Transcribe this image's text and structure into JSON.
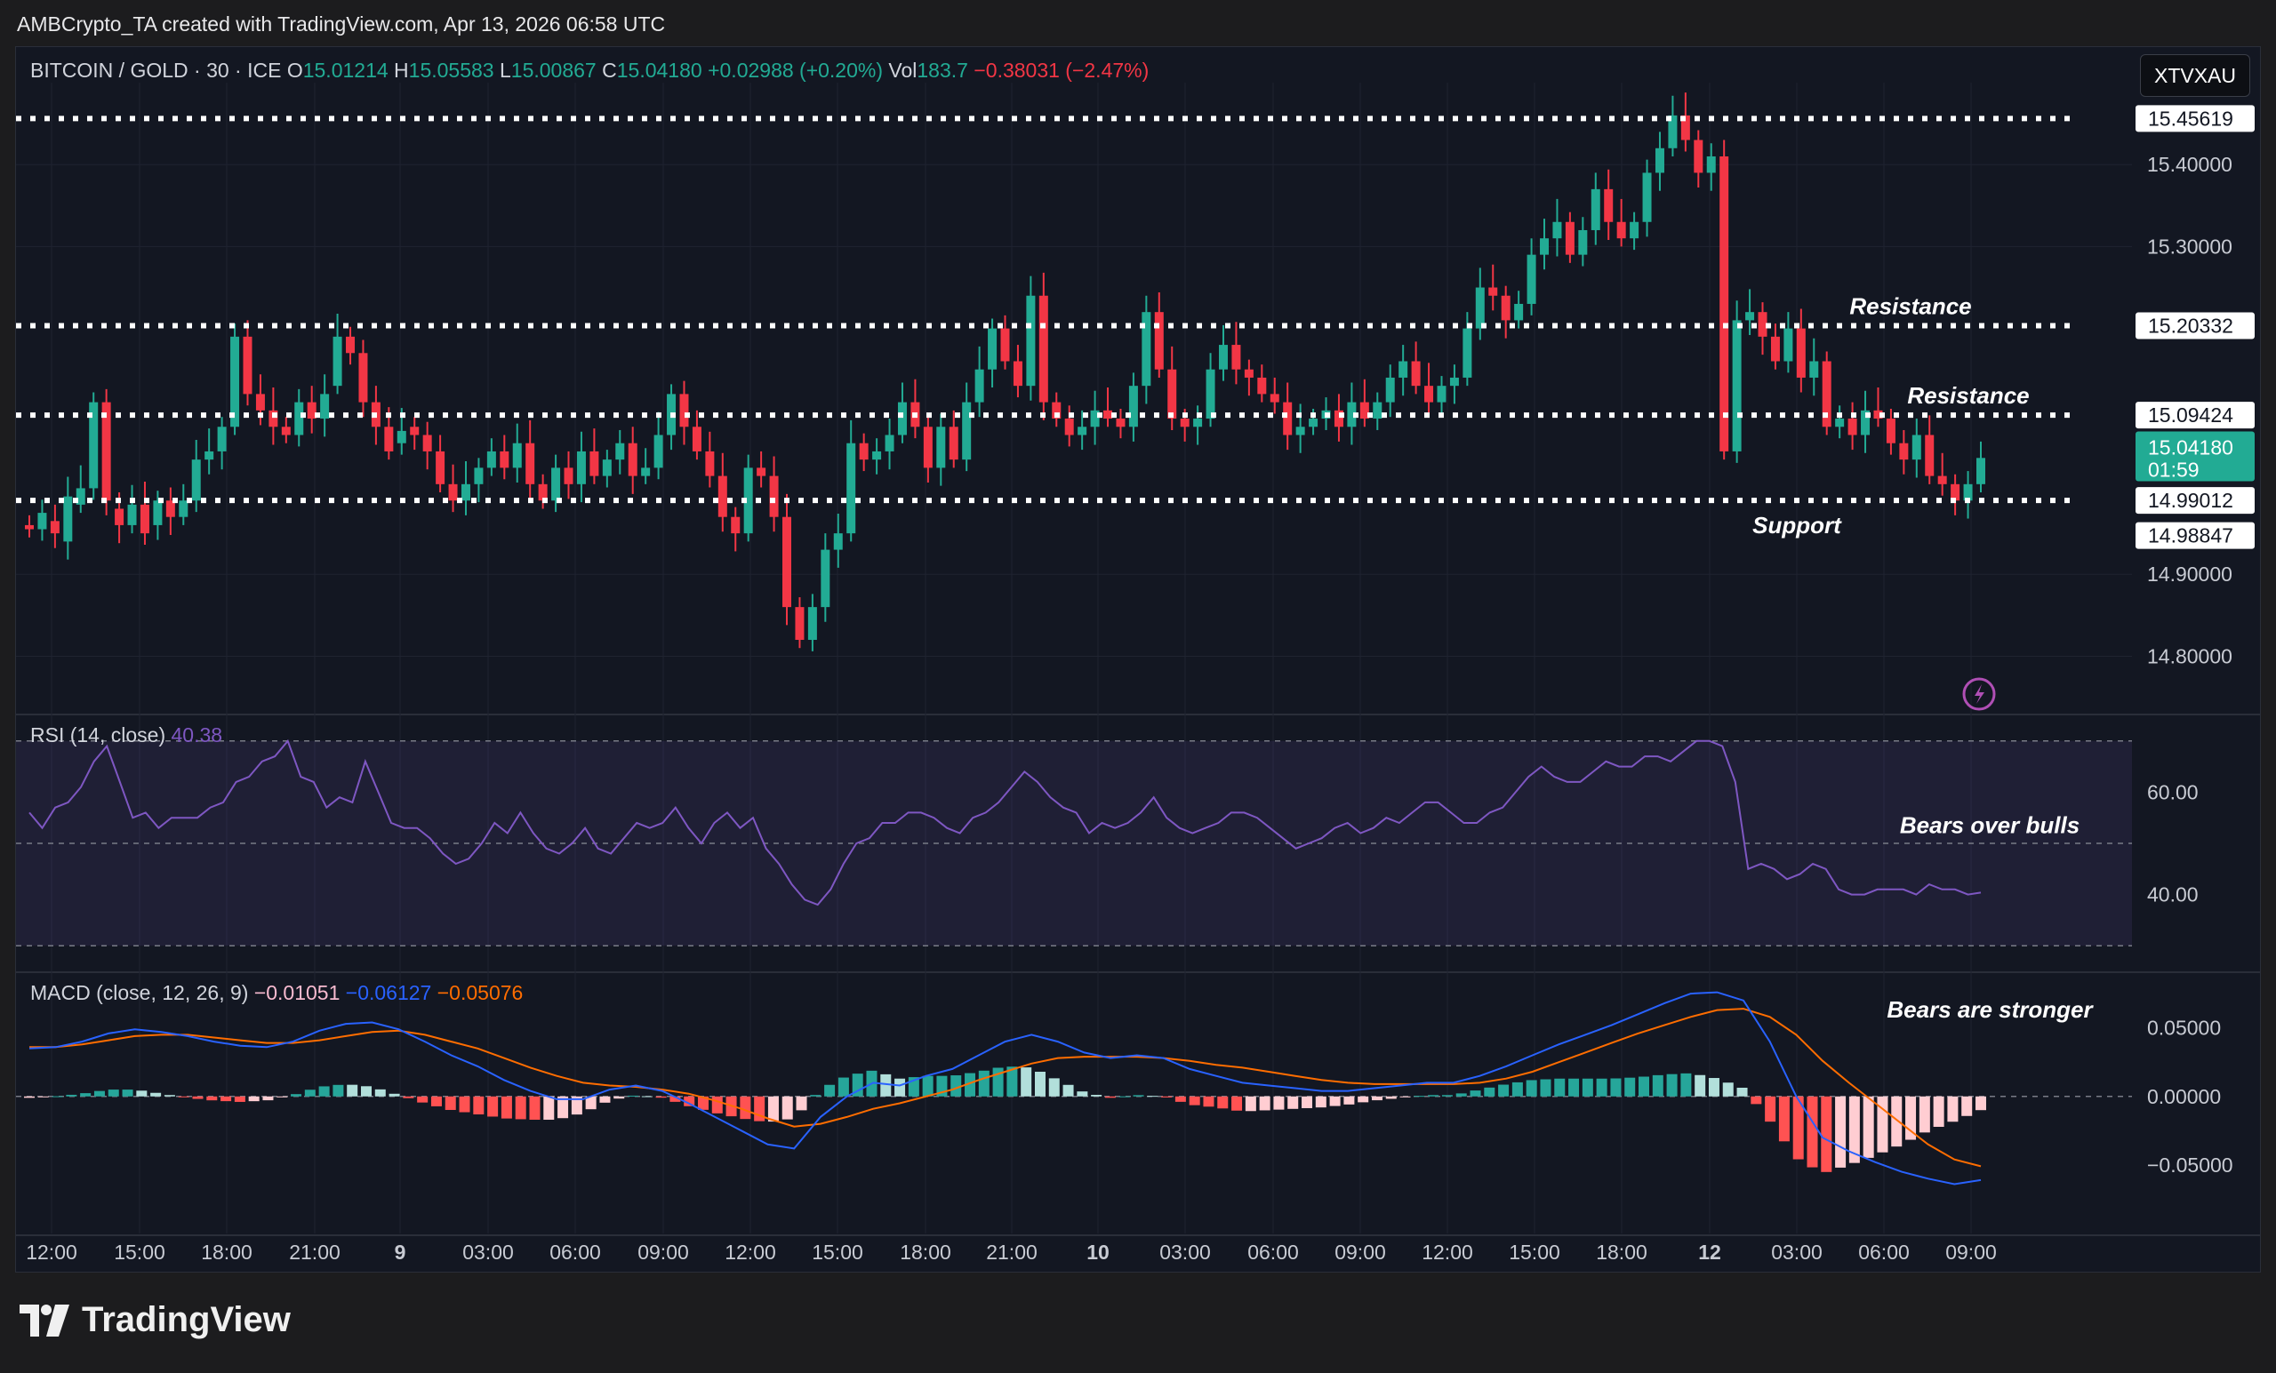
{
  "credit": "AMBCrypto_TA created with TradingView.com, Apr 13, 2026 06:58 UTC",
  "brand": {
    "name": "TradingView"
  },
  "symbol_badge": "XTVXAU",
  "legend": {
    "symbol": "BITCOIN / GOLD · 30 · ICE",
    "o_label": "O",
    "o_value": "15.01214",
    "h_label": "H",
    "h_value": "15.05583",
    "l_label": "L",
    "l_value": "15.00867",
    "c_label": "C",
    "c_value": "15.04180",
    "change": "+0.02988 (+0.20%)",
    "vol_label": "Vol",
    "vol_value": "183.7",
    "vol_change": "−0.38031 (−2.47%)"
  },
  "colors": {
    "up": "#22ab94",
    "down": "#f23645",
    "rsi": "#7e57c2",
    "macd": "#2962ff",
    "signal": "#ff6d00",
    "hist_up_strong": "#26a69a",
    "hist_up_weak": "#b2dfdb",
    "hist_down_strong": "#ff5252",
    "hist_down_weak": "#ffcdd2"
  },
  "chart_data": [
    {
      "type": "candlestick",
      "title": "BITCOIN / GOLD · 30 · ICE",
      "ylim": [
        14.73,
        15.5
      ],
      "y_ticks": [
        "15.40000",
        "15.30000",
        "14.90000",
        "14.80000"
      ],
      "x_ticks": [
        "12:00",
        "15:00",
        "18:00",
        "21:00",
        "9",
        "03:00",
        "06:00",
        "09:00",
        "12:00",
        "15:00",
        "18:00",
        "21:00",
        "10",
        "03:00",
        "06:00",
        "09:00",
        "12:00",
        "15:00",
        "18:00",
        "12",
        "03:00",
        "06:00",
        "09:00"
      ],
      "levels": [
        {
          "value": 15.45619,
          "label": "15.45619"
        },
        {
          "value": 15.20332,
          "label": "15.20332",
          "note": "Resistance"
        },
        {
          "value": 15.09424,
          "label": "15.09424",
          "note": "Resistance"
        },
        {
          "value": 14.99012,
          "label": "14.99012",
          "note": "Support"
        }
      ],
      "last_price": {
        "value": 15.0418,
        "label": "15.04180",
        "countdown": "01:59"
      },
      "low_label": {
        "value": 14.98847,
        "label": "14.98847"
      },
      "candles": [
        [
          14.96,
          14.955
        ],
        [
          14.955,
          14.975
        ],
        [
          14.965,
          14.95
        ],
        [
          14.94,
          14.995
        ],
        [
          14.985,
          15.005
        ],
        [
          15.005,
          15.11
        ],
        [
          15.11,
          14.99
        ],
        [
          14.98,
          14.96
        ],
        [
          14.96,
          14.985
        ],
        [
          14.985,
          14.95
        ],
        [
          14.96,
          14.99
        ],
        [
          14.99,
          14.97
        ],
        [
          14.97,
          14.99
        ],
        [
          14.99,
          15.04
        ],
        [
          15.04,
          15.05
        ],
        [
          15.05,
          15.08
        ],
        [
          15.08,
          15.19
        ],
        [
          15.19,
          15.12
        ],
        [
          15.12,
          15.1
        ],
        [
          15.1,
          15.08
        ],
        [
          15.08,
          15.07
        ],
        [
          15.07,
          15.11
        ],
        [
          15.11,
          15.09
        ],
        [
          15.09,
          15.12
        ],
        [
          15.13,
          15.19
        ],
        [
          15.19,
          15.17
        ],
        [
          15.17,
          15.11
        ],
        [
          15.11,
          15.08
        ],
        [
          15.08,
          15.05
        ],
        [
          15.06,
          15.075
        ],
        [
          15.08,
          15.07
        ],
        [
          15.07,
          15.05
        ],
        [
          15.05,
          15.01
        ],
        [
          15.01,
          14.99
        ],
        [
          14.99,
          15.01
        ],
        [
          15.01,
          15.03
        ],
        [
          15.03,
          15.05
        ],
        [
          15.05,
          15.03
        ],
        [
          15.03,
          15.06
        ],
        [
          15.06,
          15.01
        ],
        [
          15.01,
          14.99
        ],
        [
          14.99,
          15.03
        ],
        [
          15.03,
          15.01
        ],
        [
          15.01,
          15.05
        ],
        [
          15.05,
          15.02
        ],
        [
          15.02,
          15.04
        ],
        [
          15.04,
          15.06
        ],
        [
          15.06,
          15.02
        ],
        [
          15.02,
          15.03
        ],
        [
          15.03,
          15.07
        ],
        [
          15.07,
          15.12
        ],
        [
          15.12,
          15.08
        ],
        [
          15.08,
          15.05
        ],
        [
          15.05,
          15.02
        ],
        [
          15.02,
          14.97
        ],
        [
          14.97,
          14.95
        ],
        [
          14.95,
          15.03
        ],
        [
          15.03,
          15.02
        ],
        [
          15.02,
          14.97
        ],
        [
          14.97,
          14.86
        ],
        [
          14.86,
          14.82
        ],
        [
          14.82,
          14.86
        ],
        [
          14.86,
          14.93
        ],
        [
          14.93,
          14.95
        ],
        [
          14.95,
          15.06
        ],
        [
          15.06,
          15.04
        ],
        [
          15.04,
          15.05
        ],
        [
          15.05,
          15.07
        ],
        [
          15.07,
          15.11
        ],
        [
          15.11,
          15.08
        ],
        [
          15.08,
          15.03
        ],
        [
          15.03,
          15.08
        ],
        [
          15.08,
          15.04
        ],
        [
          15.04,
          15.11
        ],
        [
          15.11,
          15.15
        ],
        [
          15.15,
          15.2
        ],
        [
          15.2,
          15.16
        ],
        [
          15.16,
          15.13
        ],
        [
          15.13,
          15.24
        ],
        [
          15.24,
          15.11
        ],
        [
          15.11,
          15.09
        ],
        [
          15.09,
          15.07
        ],
        [
          15.07,
          15.08
        ],
        [
          15.08,
          15.1
        ],
        [
          15.1,
          15.09
        ],
        [
          15.09,
          15.08
        ],
        [
          15.08,
          15.13
        ],
        [
          15.13,
          15.22
        ],
        [
          15.22,
          15.15
        ],
        [
          15.15,
          15.09
        ],
        [
          15.09,
          15.08
        ],
        [
          15.08,
          15.09
        ],
        [
          15.09,
          15.15
        ],
        [
          15.15,
          15.18
        ],
        [
          15.18,
          15.15
        ],
        [
          15.15,
          15.14
        ],
        [
          15.14,
          15.12
        ],
        [
          15.12,
          15.11
        ],
        [
          15.11,
          15.07
        ],
        [
          15.07,
          15.08
        ],
        [
          15.08,
          15.09
        ],
        [
          15.09,
          15.1
        ],
        [
          15.1,
          15.08
        ],
        [
          15.08,
          15.11
        ],
        [
          15.11,
          15.09
        ],
        [
          15.09,
          15.11
        ],
        [
          15.11,
          15.14
        ],
        [
          15.14,
          15.16
        ],
        [
          15.16,
          15.13
        ],
        [
          15.13,
          15.11
        ],
        [
          15.11,
          15.13
        ],
        [
          15.13,
          15.14
        ],
        [
          15.14,
          15.2
        ],
        [
          15.2,
          15.25
        ],
        [
          15.25,
          15.24
        ],
        [
          15.24,
          15.21
        ],
        [
          15.21,
          15.23
        ],
        [
          15.23,
          15.29
        ],
        [
          15.29,
          15.31
        ],
        [
          15.31,
          15.33
        ],
        [
          15.33,
          15.29
        ],
        [
          15.29,
          15.32
        ],
        [
          15.32,
          15.37
        ],
        [
          15.37,
          15.33
        ],
        [
          15.33,
          15.31
        ],
        [
          15.31,
          15.33
        ],
        [
          15.33,
          15.39
        ],
        [
          15.39,
          15.42
        ],
        [
          15.42,
          15.46
        ],
        [
          15.46,
          15.43
        ],
        [
          15.43,
          15.39
        ],
        [
          15.39,
          15.41
        ],
        [
          15.41,
          15.05
        ],
        [
          15.05,
          15.21
        ],
        [
          15.21,
          15.22
        ],
        [
          15.22,
          15.19
        ],
        [
          15.19,
          15.16
        ],
        [
          15.16,
          15.2
        ],
        [
          15.2,
          15.14
        ],
        [
          15.14,
          15.16
        ],
        [
          15.16,
          15.08
        ],
        [
          15.08,
          15.09
        ],
        [
          15.09,
          15.07
        ],
        [
          15.07,
          15.1
        ],
        [
          15.1,
          15.09
        ],
        [
          15.09,
          15.06
        ],
        [
          15.06,
          15.04
        ],
        [
          15.04,
          15.07
        ],
        [
          15.07,
          15.02
        ],
        [
          15.02,
          15.01
        ],
        [
          15.01,
          14.99
        ],
        [
          14.99,
          15.01
        ],
        [
          15.01,
          15.042
        ]
      ]
    },
    {
      "type": "line",
      "title": "RSI (14, close)",
      "value_label": "40.38",
      "ylim": [
        25,
        75
      ],
      "y_ticks": [
        60,
        40
      ],
      "bands": [
        70,
        50,
        30
      ],
      "annotation": "Bears over bulls",
      "values": [
        56,
        53,
        57,
        58,
        61,
        66,
        69,
        62,
        55,
        56,
        53,
        55,
        55,
        55,
        57,
        58,
        62,
        63,
        66,
        67,
        70,
        63,
        62,
        57,
        59,
        58,
        66,
        60,
        54,
        53,
        53,
        51,
        48,
        46,
        47,
        50,
        54,
        52,
        56,
        52,
        49,
        48,
        50,
        53,
        49,
        48,
        51,
        54,
        53,
        54,
        57,
        53,
        50,
        54,
        56,
        53,
        55,
        49,
        46,
        42,
        39,
        38,
        41,
        46,
        50,
        51,
        54,
        54,
        56,
        56,
        55,
        53,
        52,
        55,
        56,
        58,
        61,
        64,
        62,
        59,
        57,
        56,
        52,
        54,
        53,
        54,
        56,
        59,
        55,
        53,
        52,
        53,
        54,
        56,
        56,
        55,
        53,
        51,
        49,
        50,
        51,
        53,
        54,
        52,
        53,
        55,
        54,
        56,
        58,
        58,
        56,
        54,
        54,
        56,
        57,
        60,
        63,
        65,
        63,
        62,
        62,
        64,
        66,
        65,
        65,
        67,
        67,
        66,
        68,
        70,
        70,
        69,
        62,
        45,
        46,
        45,
        43,
        44,
        46,
        45,
        41,
        40,
        40,
        41,
        41,
        41,
        40,
        42,
        41,
        41,
        40,
        40.38
      ]
    },
    {
      "type": "line",
      "title": "MACD (close, 12, 26, 9)",
      "values_label": [
        "−0.01051",
        "−0.06127",
        "−0.05076"
      ],
      "ylim": [
        -0.1,
        0.09
      ],
      "y_ticks": [
        "0.05000",
        "0.00000",
        "−0.05000"
      ],
      "annotation": "Bears are stronger",
      "series": [
        {
          "name": "MACD",
          "values": [
            0.035,
            0.036,
            0.04,
            0.046,
            0.049,
            0.047,
            0.044,
            0.04,
            0.037,
            0.036,
            0.04,
            0.048,
            0.053,
            0.054,
            0.049,
            0.04,
            0.03,
            0.022,
            0.012,
            0.004,
            -0.002,
            -0.002,
            0.005,
            0.008,
            0.004,
            -0.005,
            -0.015,
            -0.025,
            -0.035,
            -0.038,
            -0.015,
            0.0,
            0.01,
            0.008,
            0.015,
            0.02,
            0.03,
            0.04,
            0.045,
            0.04,
            0.032,
            0.028,
            0.03,
            0.028,
            0.02,
            0.015,
            0.01,
            0.008,
            0.006,
            0.004,
            0.004,
            0.006,
            0.008,
            0.01,
            0.01,
            0.015,
            0.022,
            0.03,
            0.038,
            0.045,
            0.052,
            0.06,
            0.068,
            0.075,
            0.076,
            0.07,
            0.04,
            0.0,
            -0.03,
            -0.04,
            -0.048,
            -0.055,
            -0.06,
            -0.064,
            -0.061
          ]
        },
        {
          "name": "Signal",
          "values": [
            0.036,
            0.036,
            0.038,
            0.041,
            0.044,
            0.045,
            0.045,
            0.043,
            0.041,
            0.039,
            0.039,
            0.041,
            0.044,
            0.047,
            0.048,
            0.045,
            0.04,
            0.035,
            0.028,
            0.021,
            0.015,
            0.01,
            0.008,
            0.007,
            0.005,
            0.002,
            -0.003,
            -0.009,
            -0.016,
            -0.022,
            -0.02,
            -0.015,
            -0.009,
            -0.005,
            0.0,
            0.005,
            0.012,
            0.018,
            0.024,
            0.028,
            0.029,
            0.029,
            0.029,
            0.028,
            0.026,
            0.023,
            0.021,
            0.018,
            0.015,
            0.012,
            0.01,
            0.009,
            0.009,
            0.009,
            0.009,
            0.01,
            0.013,
            0.018,
            0.025,
            0.032,
            0.039,
            0.046,
            0.052,
            0.058,
            0.063,
            0.064,
            0.058,
            0.045,
            0.026,
            0.01,
            -0.005,
            -0.02,
            -0.035,
            -0.046,
            -0.051
          ]
        }
      ]
    }
  ]
}
